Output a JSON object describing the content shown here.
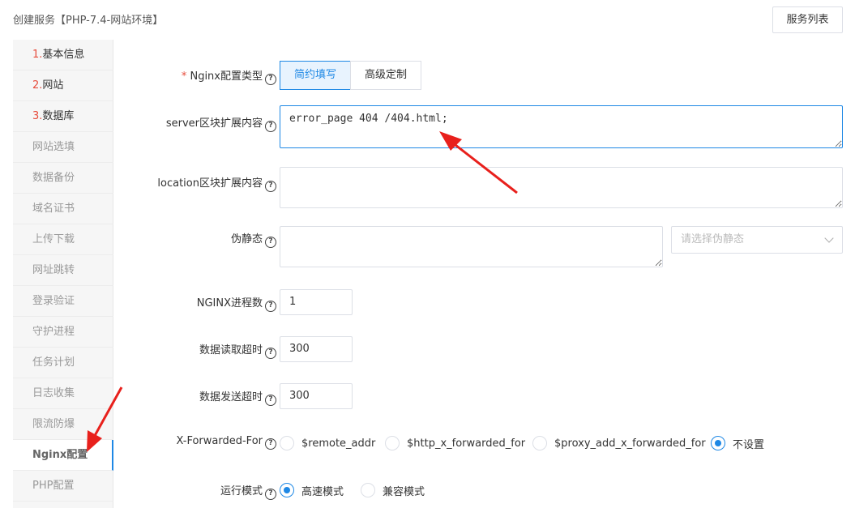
{
  "header": {
    "title": "创建服务【PHP-7.4-网站环境】",
    "list_button": "服务列表"
  },
  "sidebar": {
    "items": [
      {
        "num": "1.",
        "label": "基本信息"
      },
      {
        "num": "2.",
        "label": "网站"
      },
      {
        "num": "3.",
        "label": "数据库"
      },
      {
        "num": "",
        "label": "网站选填"
      },
      {
        "num": "",
        "label": "数据备份"
      },
      {
        "num": "",
        "label": "域名证书"
      },
      {
        "num": "",
        "label": "上传下载"
      },
      {
        "num": "",
        "label": "网址跳转"
      },
      {
        "num": "",
        "label": "登录验证"
      },
      {
        "num": "",
        "label": "守护进程"
      },
      {
        "num": "",
        "label": "任务计划"
      },
      {
        "num": "",
        "label": "日志收集"
      },
      {
        "num": "",
        "label": "限流防爆"
      },
      {
        "num": "",
        "label": "Nginx配置"
      },
      {
        "num": "",
        "label": "PHP配置"
      }
    ]
  },
  "form": {
    "nginx_type": {
      "required": "*",
      "label": "Nginx配置类型",
      "options": [
        "简约填写",
        "高级定制"
      ],
      "selected": "简约填写"
    },
    "server_block": {
      "label": "server区块扩展内容",
      "value": "error_page 404 /404.html;"
    },
    "location_block": {
      "label": "location区块扩展内容",
      "value": ""
    },
    "rewrite": {
      "label": "伪静态",
      "value": "",
      "select_placeholder": "请选择伪静态"
    },
    "nginx_processes": {
      "label": "NGINX进程数",
      "value": "1"
    },
    "read_timeout": {
      "label": "数据读取超时",
      "value": "300"
    },
    "send_timeout": {
      "label": "数据发送超时",
      "value": "300"
    },
    "x_forwarded_for": {
      "label": "X-Forwarded-For",
      "options": [
        "$remote_addr",
        "$http_x_forwarded_for",
        "$proxy_add_x_forwarded_for",
        "不设置"
      ],
      "selected": "不设置"
    },
    "run_mode": {
      "label": "运行模式",
      "options": [
        "高速模式",
        "兼容模式"
      ],
      "selected": "高速模式"
    }
  },
  "colors": {
    "accent": "#1e88e5",
    "annotation": "#e8201c",
    "required": "#e74c3c"
  }
}
